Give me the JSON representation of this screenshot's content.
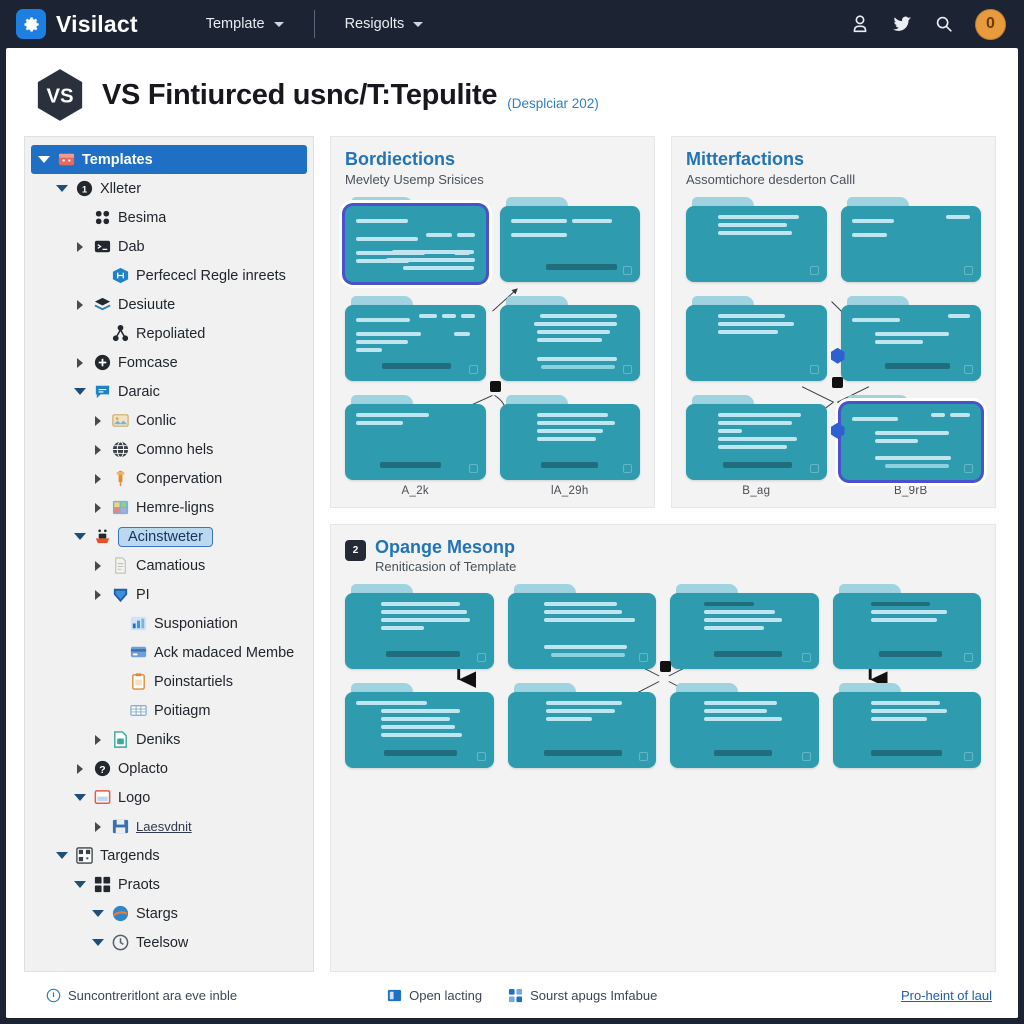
{
  "topbar": {
    "brand": "Visilact",
    "logo_icon": "gear-icon",
    "nav": [
      {
        "label": "Template",
        "icon": "chevron-down-icon"
      },
      {
        "label": "Resigolts",
        "icon": "chevron-down-icon"
      }
    ],
    "icons": [
      "user-icon",
      "twitter-bird-icon",
      "search-icon"
    ],
    "avatar_initial": "0",
    "avatar_color": "#e89a3c",
    "background": "#1c2333"
  },
  "header": {
    "logo_icon": "vs-hexagon-icon",
    "logo_text": "VS",
    "title": "VS Fintiurced usnc/T:Tepulite",
    "subtitle": "(Desplciar 202)",
    "subtitle_color": "#2f7fc4"
  },
  "sidebar": {
    "items": [
      {
        "label": "Templates",
        "indent": 0,
        "arrow": "down",
        "icon": "box-red-icon",
        "selected": true
      },
      {
        "label": "Xlleter",
        "indent": 1,
        "arrow": "down",
        "icon": "number-one-icon"
      },
      {
        "label": "Besima",
        "indent": 2,
        "arrow": "none",
        "icon": "four-dots-icon"
      },
      {
        "label": "Dab",
        "indent": 2,
        "arrow": "right",
        "icon": "terminal-icon"
      },
      {
        "label": "Perfececl Regle inreets",
        "indent": 3,
        "arrow": "none",
        "icon": "merge-blue-icon"
      },
      {
        "label": "Desiuute",
        "indent": 2,
        "arrow": "right",
        "icon": "layers-icon"
      },
      {
        "label": "Repoliated",
        "indent": 3,
        "arrow": "none",
        "icon": "share-nodes-icon"
      },
      {
        "label": "Fomcase",
        "indent": 2,
        "arrow": "right",
        "icon": "plus-circle-icon"
      },
      {
        "label": "Daraic",
        "indent": 2,
        "arrow": "down",
        "icon": "comment-blue-icon"
      },
      {
        "label": "Conlic",
        "indent": 3,
        "arrow": "right",
        "icon": "image-icon"
      },
      {
        "label": "Comno hels",
        "indent": 3,
        "arrow": "right",
        "icon": "globe-icon"
      },
      {
        "label": "Conpervation",
        "indent": 3,
        "arrow": "right",
        "icon": "pin-orange-icon"
      },
      {
        "label": "Hemre-ligns",
        "indent": 3,
        "arrow": "right",
        "icon": "grid-color-icon"
      },
      {
        "label": "Acinstweter",
        "indent": 2,
        "arrow": "down",
        "icon": "robot-icon",
        "boxed": true
      },
      {
        "label": "Camatious",
        "indent": 3,
        "arrow": "right",
        "icon": "document-icon"
      },
      {
        "label": "PI",
        "indent": 3,
        "arrow": "right",
        "icon": "shield-blue-icon"
      },
      {
        "label": "Susponiation",
        "indent": 4,
        "arrow": "none",
        "icon": "chart-icon"
      },
      {
        "label": "Ack madaced Membe",
        "indent": 4,
        "arrow": "none",
        "icon": "card-icon"
      },
      {
        "label": "Poinstartiels",
        "indent": 4,
        "arrow": "none",
        "icon": "clipboard-orange-icon"
      },
      {
        "label": "Poitiagm",
        "indent": 4,
        "arrow": "none",
        "icon": "table-icon"
      },
      {
        "label": "Deniks",
        "indent": 3,
        "arrow": "right",
        "icon": "file-teal-icon"
      },
      {
        "label": "Oplacto",
        "indent": 2,
        "arrow": "right",
        "icon": "question-circle-icon"
      },
      {
        "label": "Logo",
        "indent": 2,
        "arrow": "down",
        "icon": "frame-red-icon"
      },
      {
        "label": "Laesvdnit",
        "indent": 3,
        "arrow": "right",
        "icon": "save-icon",
        "link": true
      },
      {
        "label": "Targends",
        "indent": 1,
        "arrow": "down",
        "icon": "qr-icon"
      },
      {
        "label": "Praots",
        "indent": 2,
        "arrow": "down",
        "icon": "grid-blue-icon"
      },
      {
        "label": "Stargs",
        "indent": 3,
        "arrow": "down",
        "icon": "sphere-icon"
      },
      {
        "label": "Teelsow",
        "indent": 3,
        "arrow": "down",
        "icon": "clock-icon"
      }
    ]
  },
  "panels": [
    {
      "title": "Bordiections",
      "subtitle": "Mevlety Usemp Srisices",
      "badge": null,
      "captions": [
        "A_2k",
        "lA_29h"
      ]
    },
    {
      "title": "Mitterfactions",
      "subtitle": "Assomtichore desderton Calll",
      "badge": null,
      "captions": [
        "B_ag",
        "B_9rB"
      ]
    },
    {
      "title": "Opange Mesonp",
      "subtitle": "Reniticasion of Template",
      "badge": "2",
      "captions": []
    }
  ],
  "footer": {
    "left": {
      "label": "Suncontreritlont ara eve inble",
      "icon": "info-circle-icon"
    },
    "middle": [
      {
        "label": "Open lacting",
        "icon": "window-blue-icon"
      },
      {
        "label": "Sourst apugs Imfabue",
        "icon": "blocks-blue-icon"
      }
    ],
    "link": "Pro-heint of laul"
  },
  "colors": {
    "accent": "#1f6fc4",
    "card": "#2f9bae",
    "selection": "#4b51cd",
    "title": "#2273b7"
  }
}
